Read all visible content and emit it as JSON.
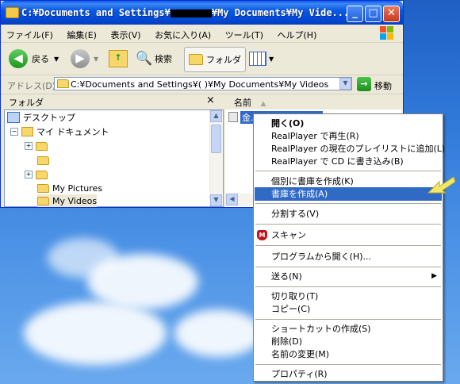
{
  "window": {
    "title_prefix": "C:¥Documents and Settings¥",
    "title_suffix": "¥My Documents¥My Vide...",
    "min_glyph": "_",
    "max_glyph": "□",
    "close_glyph": "✕"
  },
  "menubar": [
    "ファイル(F)",
    "編集(E)",
    "表示(V)",
    "お気に入り(A)",
    "ツール(T)",
    "ヘルプ(H)"
  ],
  "toolbar": {
    "back_label": "戻る",
    "search_label": "検索",
    "folders_label": "フォルダ"
  },
  "address": {
    "label": "アドレス(D)",
    "value": "C:¥Documents and Settings¥(      )¥My Documents¥My Videos",
    "go_label": "移動"
  },
  "folder_pane": {
    "header": "フォルダ",
    "close_glyph": "×",
    "items": [
      {
        "label": "デスクトップ"
      },
      {
        "label": "マイ ドキュメント"
      },
      {
        "label": ""
      },
      {
        "label": ""
      },
      {
        "label": ""
      },
      {
        "label": "My Pictures"
      },
      {
        "label": "My Videos"
      }
    ]
  },
  "file_pane": {
    "header": "名前",
    "file_name": "金..."
  },
  "context_menu": {
    "items": [
      {
        "label": "開く(O)",
        "bold": true
      },
      {
        "label": "RealPlayer で再生(R)"
      },
      {
        "label": "RealPlayer の現在のプレイリストに追加(L)"
      },
      {
        "label": "RealPlayer で CD に書き込み(B)"
      },
      {
        "label": "個別に書庫を作成(K)"
      },
      {
        "label": "書庫を作成(A)",
        "selected": true
      },
      {
        "label": "分割する(V)"
      },
      {
        "label": "スキャン"
      },
      {
        "label": "プログラムから開く(H)..."
      },
      {
        "label": "送る(N)",
        "submenu": true
      },
      {
        "label": "切り取り(T)"
      },
      {
        "label": "コピー(C)"
      },
      {
        "label": "ショートカットの作成(S)"
      },
      {
        "label": "削除(D)"
      },
      {
        "label": "名前の変更(M)"
      },
      {
        "label": "プロパティ(R)"
      }
    ]
  },
  "colors": {
    "selection": "#316ac5",
    "titlebar": "#0a58e8",
    "pointer_arrow": "#f3e76a"
  }
}
